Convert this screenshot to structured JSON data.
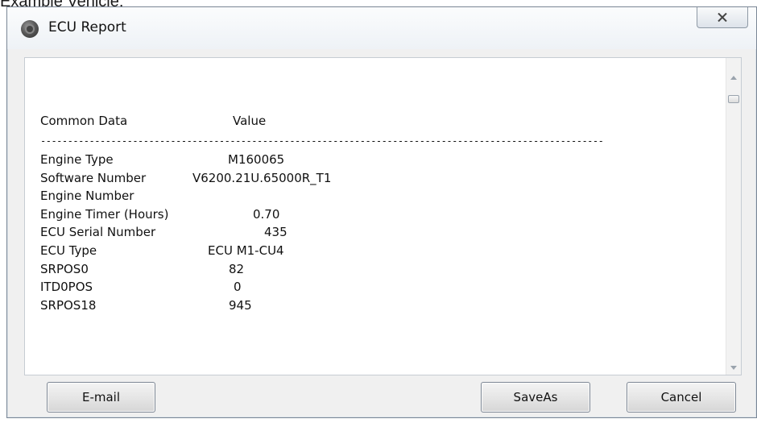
{
  "caption": "Example Vehicle:",
  "window": {
    "title": "ECU Report",
    "close_icon": "close-x-icon",
    "app_icon": "ecu-icon"
  },
  "report": {
    "header": {
      "col1": "Common Data",
      "col2": "Value"
    },
    "divider": "----------------------------------------------------------------------------------------------------------",
    "rows": [
      {
        "key": "Engine Type",
        "value": "M160065"
      },
      {
        "key": "Software Number",
        "value": "V6200.21U.65000R_T1"
      },
      {
        "key": "Engine Number",
        "value": ""
      },
      {
        "key": "Engine Timer (Hours)",
        "value": "0.70"
      },
      {
        "key": "ECU Serial Number",
        "value": "435"
      },
      {
        "key": "ECU Type",
        "value": "ECU M1-CU4"
      },
      {
        "key": "SRPOS0",
        "value": "82"
      },
      {
        "key": "ITD0POS",
        "value": "0"
      },
      {
        "key": "SRPOS18",
        "value": "945"
      }
    ]
  },
  "buttons": {
    "email": "E-mail",
    "saveas": "SaveAs",
    "cancel": "Cancel"
  }
}
